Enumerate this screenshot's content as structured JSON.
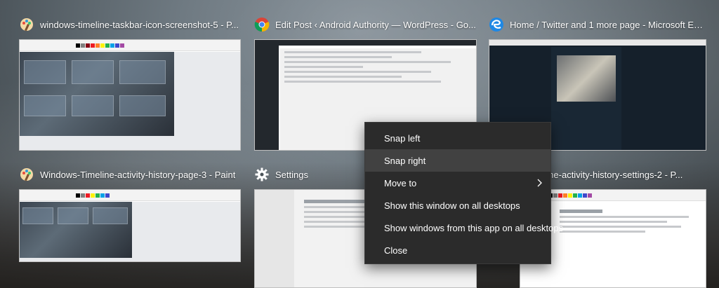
{
  "windows": [
    {
      "id": "paint-1",
      "title": "windows-timeline-taskbar-icon-screenshot-5 - P...",
      "icon": "paint-icon"
    },
    {
      "id": "chrome",
      "title": "Edit Post ‹ Android Authority — WordPress - Go...",
      "icon": "chrome-icon"
    },
    {
      "id": "edge",
      "title": "Home / Twitter and 1 more page - Microsoft Ed...",
      "icon": "edge-icon"
    },
    {
      "id": "paint-2",
      "title": "Windows-Timeline-activity-history-page-3 - Paint",
      "icon": "paint-icon"
    },
    {
      "id": "settings",
      "title": "Settings",
      "icon": "gear-icon"
    },
    {
      "id": "paint-3",
      "title": "...timeline-activity-history-settings-2 - P...",
      "icon": "paint-icon"
    }
  ],
  "context_menu": {
    "items": [
      {
        "label": "Snap left",
        "hover": false,
        "submenu": false
      },
      {
        "label": "Snap right",
        "hover": true,
        "submenu": false
      },
      {
        "label": "Move to",
        "hover": false,
        "submenu": true
      },
      {
        "label": "Show this window on all desktops",
        "hover": false,
        "submenu": false
      },
      {
        "label": "Show windows from this app on all desktops",
        "hover": false,
        "submenu": false
      },
      {
        "label": "Close",
        "hover": false,
        "submenu": false
      }
    ]
  },
  "colors": {
    "menu_bg": "#2b2b2b",
    "menu_hover": "#414141",
    "menu_text": "#ffffff"
  }
}
